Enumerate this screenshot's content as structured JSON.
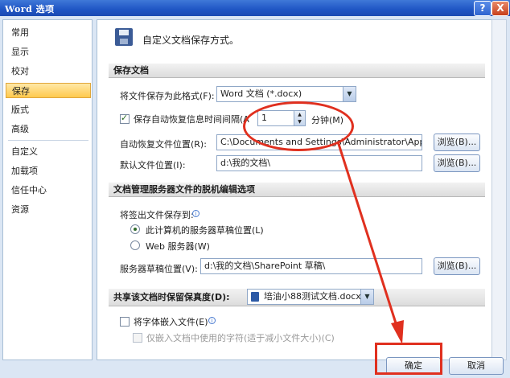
{
  "window": {
    "title": "Word 选项",
    "help_glyph": "?",
    "close_glyph": "X"
  },
  "nav": {
    "items": [
      {
        "label": "常用"
      },
      {
        "label": "显示"
      },
      {
        "label": "校对"
      },
      {
        "label": "保存",
        "selected": true
      },
      {
        "label": "版式"
      },
      {
        "label": "高级"
      },
      {
        "label": "自定义"
      },
      {
        "label": "加载项"
      },
      {
        "label": "信任中心"
      },
      {
        "label": "资源"
      }
    ]
  },
  "header": {
    "icon": "floppy-disk-icon",
    "text": "自定义文档保存方式。"
  },
  "save_docs": {
    "heading": "保存文档",
    "format_label": "将文件保存为此格式(F):",
    "format_value": "Word 文档 (*.docx)",
    "autorecover_label": "保存自动恢复信息时间间隔(A",
    "autorecover_checked": true,
    "autorecover_value": "1",
    "minutes_label": "分钟(M)",
    "autorecover_path_label": "自动恢复文件位置(R):",
    "autorecover_path": "C:\\Documents and Settings\\Administrator\\Appli",
    "default_path_label": "默认文件位置(I):",
    "default_path": "d:\\我的文档\\",
    "browse1": "浏览(B)...",
    "browse2": "浏览(B)..."
  },
  "offline": {
    "heading": "文档管理服务器文件的脱机编辑选项",
    "checkout_label": "将签出文件保存到:",
    "option1": "此计算机的服务器草稿位置(L)",
    "option2": "Web 服务器(W)",
    "selected_option": 1,
    "drafts_label": "服务器草稿位置(V):",
    "drafts_path": "d:\\我的文档\\SharePoint 草稿\\",
    "browse": "浏览(B)..."
  },
  "fidelity": {
    "heading": "共享该文档时保留保真度(D):",
    "doc_value": "培油小88测试文档.docx",
    "embed_fonts_label": "将字体嵌入文件(E)",
    "embed_fonts_checked": false,
    "embed_used_chars_label": "仅嵌入文档中使用的字符(适于减小文件大小)(C)"
  },
  "footer": {
    "ok": "确定",
    "cancel": "取消"
  },
  "colors": {
    "accent": "#1f55c4",
    "selection": "#ffc94d",
    "annotation": "#e0301f"
  }
}
